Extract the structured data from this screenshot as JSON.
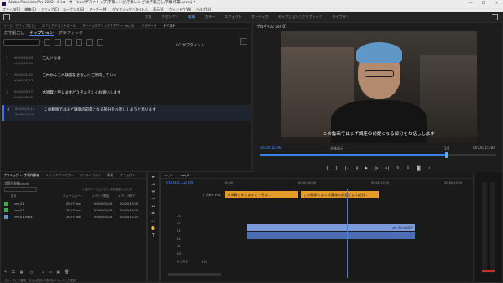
{
  "window": {
    "title": "Adobe Premiere Pro 2022 - C:\\ユーザー\\kun\\デスクトップ\\字幕レシピ\\字幕レシピ\\文字起こし\\字幕 作業.prproj *",
    "min": "—",
    "max": "☐",
    "close": "✕"
  },
  "menu": [
    "ファイル(F)",
    "編集(E)",
    "クリップ(C)",
    "シーケンス(S)",
    "マーカー(M)",
    "グラフィックとタイトル",
    "表示(V)",
    "ウィンドウ(W)",
    "ヘルプ(H)"
  ],
  "workspaces": {
    "tabs": [
      "学習",
      "アセンブリ",
      "編集",
      "カラー",
      "エフェクト",
      "オーディオ",
      "キャプションとグラフィック",
      "ライブラリ"
    ],
    "active_index": 2
  },
  "top_panel": {
    "tabs": [
      "ソース: (クリップなし)",
      "エフェクトコントロール",
      "オーディオクリップミキサー: ver_01",
      "メタデータ",
      "テキスト"
    ],
    "active_index": 4,
    "subtabs": [
      "文字起こし",
      "キャプション",
      "グラフィック"
    ],
    "active_subtab": 1,
    "search_placeholder": "",
    "track_label": "CC サブタイトル"
  },
  "captions": [
    {
      "num": "1",
      "in": "00;00;00;43",
      "out": "00;00;01;41",
      "text": "こんにちは"
    },
    {
      "num": "2",
      "in": "00;00;01;41",
      "out": "00;00;05;17",
      "text": "これからこの講座を皆さんにご案内していく"
    },
    {
      "num": "3",
      "in": "00;00;05;17",
      "out": "00;00;08;45",
      "text": "大須賀と申しますどうぞよろしくお願いします"
    },
    {
      "num": "4",
      "in": "00;00;09;12",
      "out": "00;00;14;00",
      "text": "この動画ではまず講座の前提となる部分をお話ししようと思います"
    }
  ],
  "program": {
    "title": "プログラム: ver_01",
    "subtitle": "この動画ではまず講座の前提となる部分をお話しします",
    "timecode": "00;00;12;06",
    "fit": "全体表示",
    "quality": "1/2",
    "duration": "00;00;15;10"
  },
  "project": {
    "tabs": [
      "プロジェクト: 字幕作業箱",
      "メディアブラウザー",
      "CC ライブラリ",
      "情報",
      "エフェクト"
    ],
    "file": "字幕作業箱.prproj",
    "status": "1 個のアイテムから 1 個を選択しました",
    "columns": [
      "名前",
      "フレームレート",
      "メディア開始",
      "メディア終了"
    ],
    "rows": [
      {
        "name": "ver_01",
        "fps": "29.97 fps",
        "start": "00;00;00;00",
        "end": "00;00;15;09",
        "color": "#2ab64a"
      },
      {
        "name": "ver_01",
        "fps": "29.97 fps",
        "start": "00;00;00;00",
        "end": "00;00;15;09",
        "color": "#2ab64a"
      },
      {
        "name": "ver_01.mp4",
        "fps": "29.97 fps",
        "start": "00;00;00;00",
        "end": "00;00;14;29",
        "color": "#5c8fd0"
      }
    ],
    "footer_status": "クリックして選択、または空白の領域をクリックして選択"
  },
  "timeline": {
    "tabs": [
      "ver_01",
      "ver_01"
    ],
    "timecode": "00;00;12;06",
    "ruler": [
      "00;00",
      "00;00;05;00",
      "00;00;10;00",
      "00;00;15;00"
    ],
    "caption_track": "サブタイトル",
    "caption_clips": [
      "大須賀と申しますどうぞよ…",
      "この動画ではまず講座の前提となる部分…"
    ],
    "video_tracks": [
      "V3",
      "V2",
      "V1"
    ],
    "audio_tracks": [
      "A1",
      "A2",
      "A3"
    ],
    "video_clip": "ver_01.mp4 [V]",
    "mix_label": "ミックス",
    "mix_value": "0.0"
  }
}
